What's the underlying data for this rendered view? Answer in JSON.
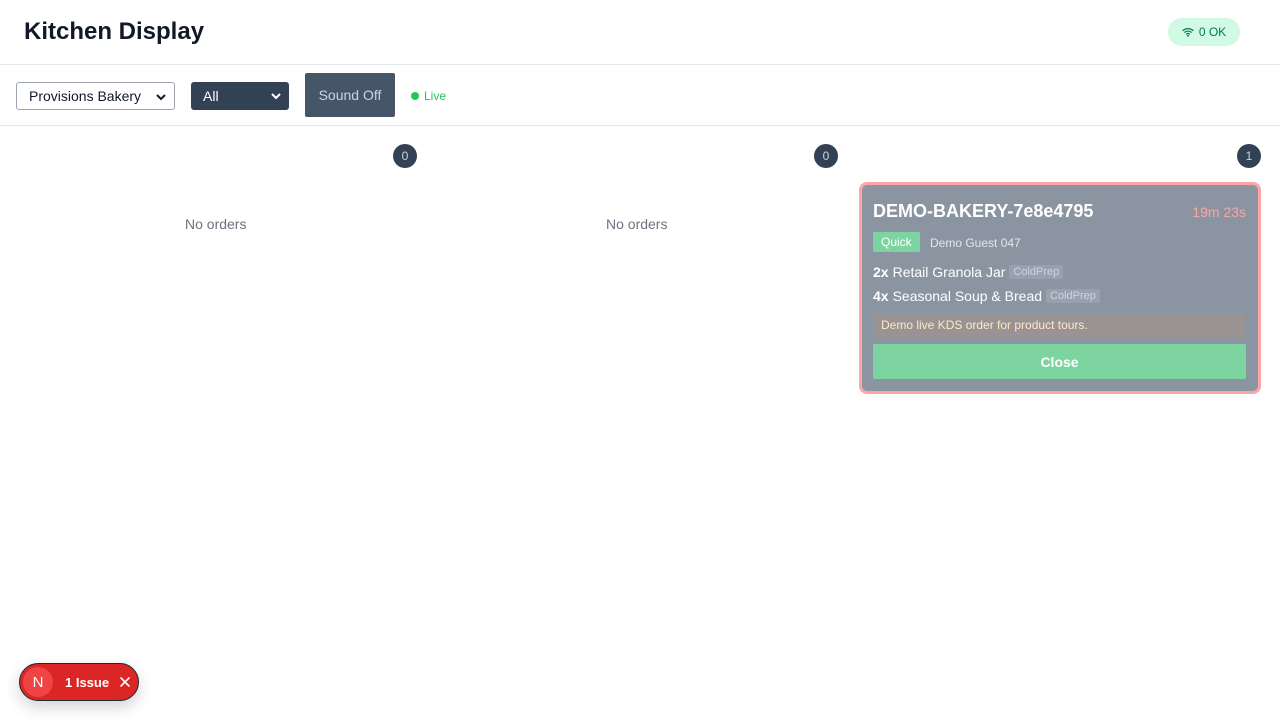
{
  "header": {
    "title": "Kitchen Display",
    "status_label": "0 OK",
    "status_icon": "wifi-icon"
  },
  "toolbar": {
    "store_value": "Provisions Bakery",
    "station_value": "All",
    "sound_label": "Sound Off",
    "live_label": "Live"
  },
  "columns": [
    {
      "count": "0",
      "empty_label": "No orders"
    },
    {
      "count": "0",
      "empty_label": "No orders"
    },
    {
      "count": "1"
    }
  ],
  "order": {
    "id": "DEMO-BAKERY-7e8e4795",
    "timer": "19m 23s",
    "tag": "Quick",
    "guest": "Demo Guest 047",
    "items": [
      {
        "qty": "2x",
        "name": "Retail Granola Jar",
        "station": "ColdPrep"
      },
      {
        "qty": "4x",
        "name": "Seasonal Soup & Bread",
        "station": "ColdPrep"
      }
    ],
    "note": "Demo live KDS order for product tours.",
    "close_label": "Close"
  },
  "issues": {
    "logo": "N",
    "label": "1 Issue"
  },
  "colors": {
    "card_border": "#fca5a5",
    "live": "#22c55e",
    "close": "#7ed4a0",
    "issue": "#dc2626"
  }
}
